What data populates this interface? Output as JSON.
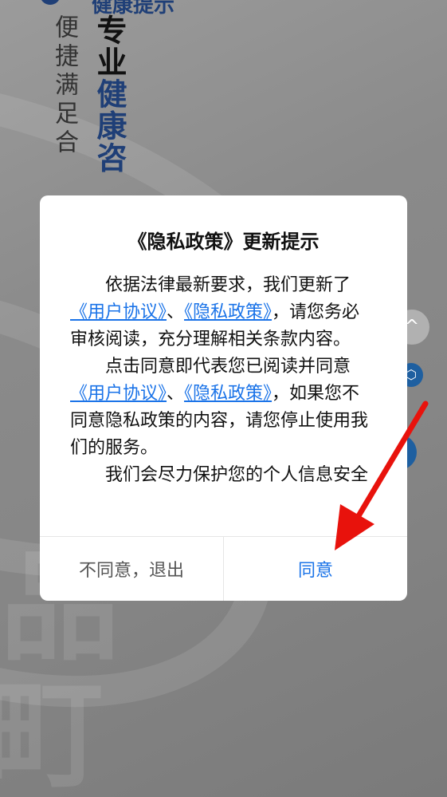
{
  "background": {
    "top_clipped_text": "健康提示",
    "vertical_small_text": "便捷满足合",
    "vertical_big_text_dark": "专业",
    "vertical_big_text_blue": "健康咨",
    "side_buttons": [
      "^",
      "⬡",
      "●"
    ],
    "watermark_glyphs": [
      "品",
      "町"
    ]
  },
  "dialog": {
    "title": "《隐私政策》更新提示",
    "paragraph1_prefix": "依据法律最新要求，我们更新了",
    "link_user_agreement": "《用户协议》",
    "separator": "、",
    "link_privacy_policy": "《隐私政策》",
    "paragraph1_suffix": "，请您务必审核阅读，充分理解相关条款内容。",
    "paragraph2_prefix": "点击同意即代表您已阅读并同意",
    "paragraph2_suffix": "，如果您不同意隐私政策的内容，请您停止使用我们的服务。",
    "paragraph3": "我们会尽力保护您的个人信息安全",
    "cancel_label": "不同意，退出",
    "ok_label": "同意"
  },
  "colors": {
    "link": "#1a73e8",
    "arrow": "#e8120c",
    "brand_blue": "#1f3f77"
  }
}
